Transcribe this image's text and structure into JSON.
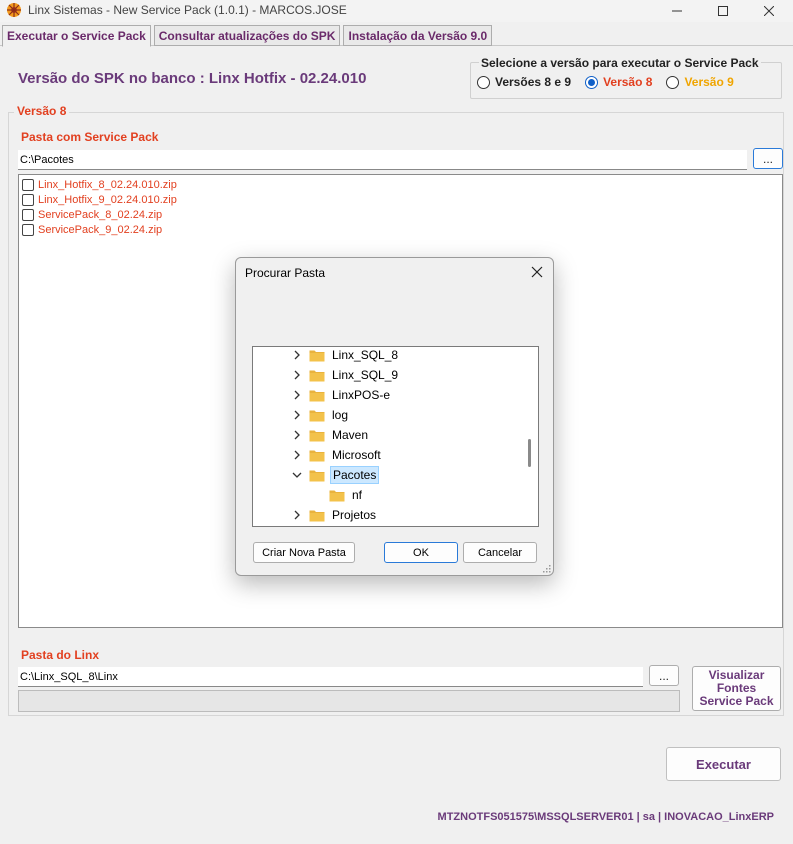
{
  "window": {
    "title": "Linx Sistemas - New Service Pack (1.0.1) - MARCOS.JOSE"
  },
  "tabs": [
    {
      "label": "Executar o Service Pack",
      "active": true
    },
    {
      "label": "Consultar atualizações do SPK",
      "active": false
    },
    {
      "label": "Instalação da Versão 9.0",
      "active": false
    }
  ],
  "main": {
    "spk_version_label": "Versão do SPK no banco : Linx Hotfix - 02.24.010",
    "version_selector": {
      "title": "Selecione a versão para executar o Service Pack",
      "options": [
        {
          "label": "Versões 8 e 9",
          "color": "#222222",
          "checked": false
        },
        {
          "label": "Versão 8",
          "color": "#e24020",
          "checked": true
        },
        {
          "label": "Versão 9",
          "color": "#f0a500",
          "checked": false
        }
      ]
    },
    "group_title": "Versão 8",
    "service_pack_folder_label": "Pasta com Service Pack",
    "service_pack_folder_value": "C:\\Pacotes",
    "browse_label": "...",
    "files": [
      "Linx_Hotfix_8_02.24.010.zip",
      "Linx_Hotfix_9_02.24.010.zip",
      "ServicePack_8_02.24.zip",
      "ServicePack_9_02.24.zip"
    ],
    "linx_folder_label": "Pasta do Linx",
    "linx_folder_value": "C:\\Linx_SQL_8\\Linx",
    "view_sources_label": "Visualizar\nFontes\nService Pack",
    "progress": 0,
    "execute_label": "Executar",
    "status": "MTZNOTFS051575\\MSSQLSERVER01 | sa | INOVACAO_LinxERP"
  },
  "dialog": {
    "title": "Procurar Pasta",
    "tree": [
      {
        "label": "Linx_SQL_8",
        "expanded": false,
        "level": 0
      },
      {
        "label": "Linx_SQL_9",
        "expanded": false,
        "level": 0
      },
      {
        "label": "LinxPOS-e",
        "expanded": false,
        "level": 0
      },
      {
        "label": "log",
        "expanded": false,
        "level": 0
      },
      {
        "label": "Maven",
        "expanded": false,
        "level": 0
      },
      {
        "label": "Microsoft",
        "expanded": false,
        "level": 0
      },
      {
        "label": "Pacotes",
        "expanded": true,
        "level": 0,
        "selected": true
      },
      {
        "label": "nf",
        "expanded": null,
        "level": 1
      },
      {
        "label": "Projetos",
        "expanded": false,
        "level": 0
      }
    ],
    "new_folder_label": "Criar Nova Pasta",
    "ok_label": "OK",
    "cancel_label": "Cancelar"
  },
  "colors": {
    "accent_purple": "#6a3a7a",
    "label_red": "#e24020",
    "folder_yellow": "#f3c24a"
  }
}
